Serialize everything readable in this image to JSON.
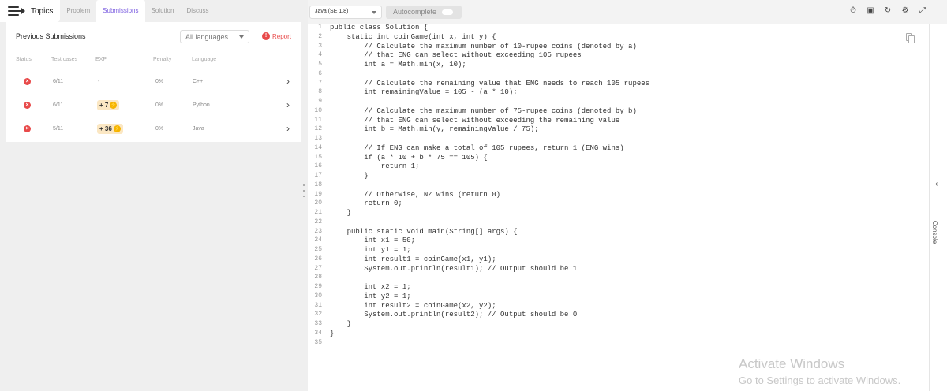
{
  "nav": {
    "topics": "Topics",
    "tabs": [
      "Problem",
      "Submissions",
      "Solution",
      "Discuss"
    ],
    "active_tab": "Submissions",
    "accent": "#7b5de0"
  },
  "submissions": {
    "title": "Previous Submissions",
    "filter": "All languages",
    "report": "Report",
    "headers": [
      "Status",
      "Test cases",
      "EXP",
      "Penalty",
      "Language"
    ],
    "rows": [
      {
        "tests": "6/11",
        "exp": "-",
        "penalty": "0%",
        "language": "C++"
      },
      {
        "tests": "6/11",
        "exp": "+ 7",
        "penalty": "0%",
        "language": "Python"
      },
      {
        "tests": "5/11",
        "exp": "+ 36",
        "penalty": "0%",
        "language": "Java"
      }
    ]
  },
  "editor": {
    "language": "Java (SE 1.8)",
    "autocomplete": "Autocomplete",
    "lines": [
      "public class Solution {",
      "    static int coinGame(int x, int y) {",
      "        // Calculate the maximum number of 10-rupee coins (denoted by a)",
      "        // that ENG can select without exceeding 105 rupees",
      "        int a = Math.min(x, 10);",
      "",
      "        // Calculate the remaining value that ENG needs to reach 105 rupees",
      "        int remainingValue = 105 - (a * 10);",
      "",
      "        // Calculate the maximum number of 75-rupee coins (denoted by b)",
      "        // that ENG can select without exceeding the remaining value",
      "        int b = Math.min(y, remainingValue / 75);",
      "",
      "        // If ENG can make a total of 105 rupees, return 1 (ENG wins)",
      "        if (a * 10 + b * 75 == 105) {",
      "            return 1;",
      "        }",
      "",
      "        // Otherwise, NZ wins (return 0)",
      "        return 0;",
      "    }",
      "",
      "    public static void main(String[] args) {",
      "        int x1 = 50;",
      "        int y1 = 1;",
      "        int result1 = coinGame(x1, y1);",
      "        System.out.println(result1); // Output should be 1",
      "",
      "        int x2 = 1;",
      "        int y2 = 1;",
      "        int result2 = coinGame(x2, y2);",
      "        System.out.println(result2); // Output should be 0",
      "    }",
      "}",
      ""
    ]
  },
  "console": "Console",
  "watermark": {
    "title": "Activate Windows",
    "subtitle": "Go to Settings to activate Windows."
  }
}
